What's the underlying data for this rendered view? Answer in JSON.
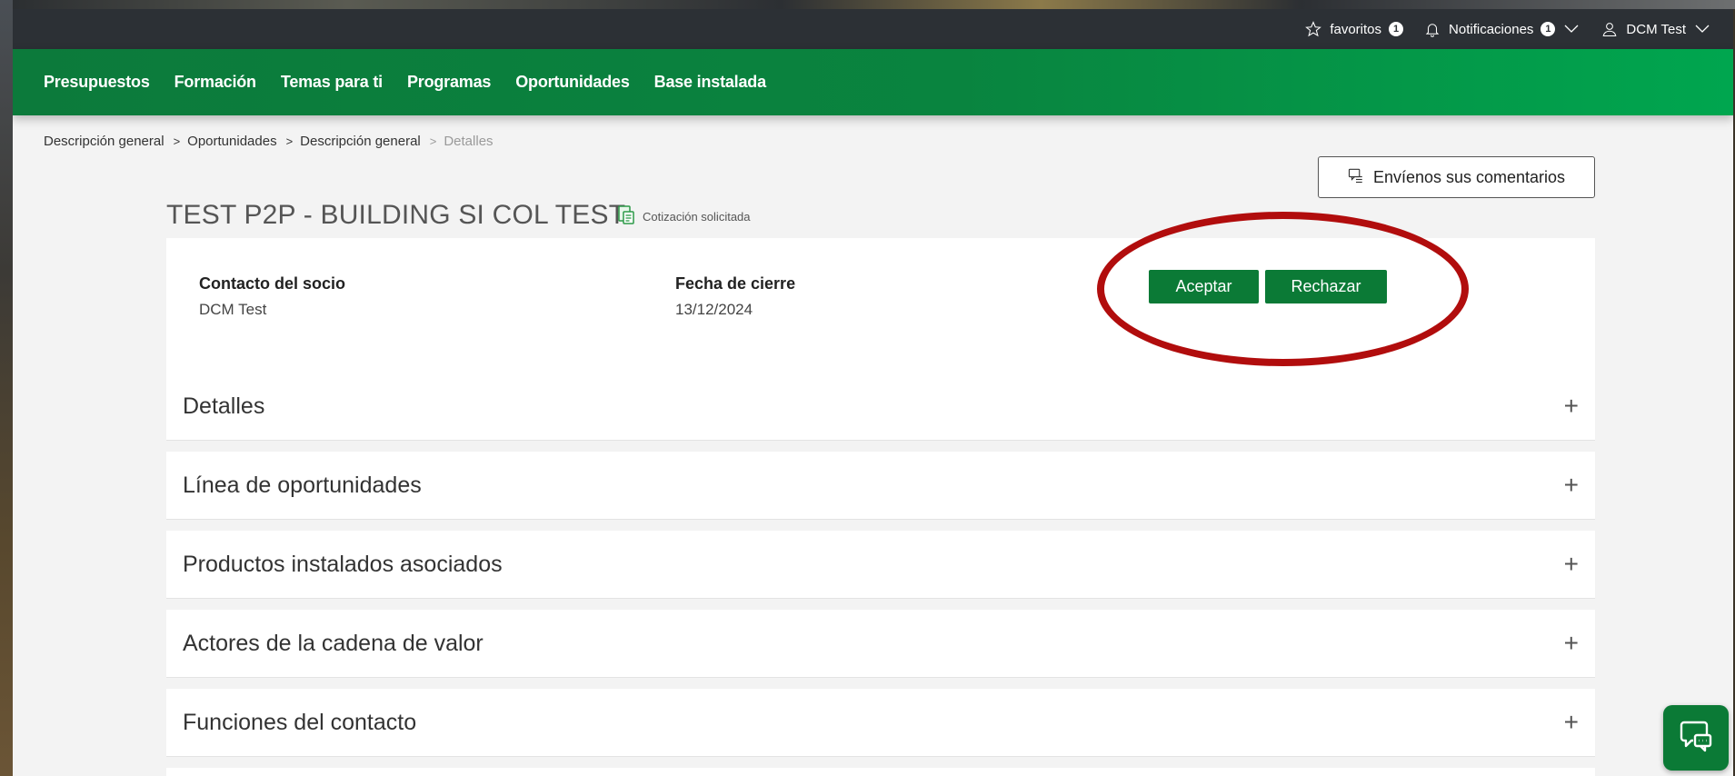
{
  "topbar": {
    "favorites_label": "favoritos",
    "favorites_count": "1",
    "notifications_label": "Notificaciones",
    "notifications_count": "1",
    "user_label": "DCM Test"
  },
  "nav": {
    "items": [
      "Presupuestos",
      "Formación",
      "Temas para ti",
      "Programas",
      "Oportunidades",
      "Base instalada"
    ]
  },
  "breadcrumb": {
    "items": [
      "Descripción general",
      "Oportunidades",
      "Descripción general",
      "Detalles"
    ],
    "separator": ">"
  },
  "feedback": {
    "label": "Envíenos sus comentarios"
  },
  "page": {
    "title": "TEST P2P - BUILDING SI COL TEST",
    "status": "Cotización solicitada"
  },
  "summary": {
    "contact_label": "Contacto del socio",
    "contact_value": "DCM Test",
    "close_date_label": "Fecha de cierre",
    "close_date_value": "13/12/2024",
    "accept_label": "Aceptar",
    "reject_label": "Rechazar"
  },
  "accordion": {
    "plus": "+",
    "sections": [
      "Detalles",
      "Línea de oportunidades",
      "Productos instalados asociados",
      "Actores de la cadena de valor",
      "Funciones del contacto"
    ]
  },
  "colors": {
    "primary_green": "#0b7a36",
    "topbar": "#2c3035",
    "annotation_red": "#b10d0d"
  }
}
